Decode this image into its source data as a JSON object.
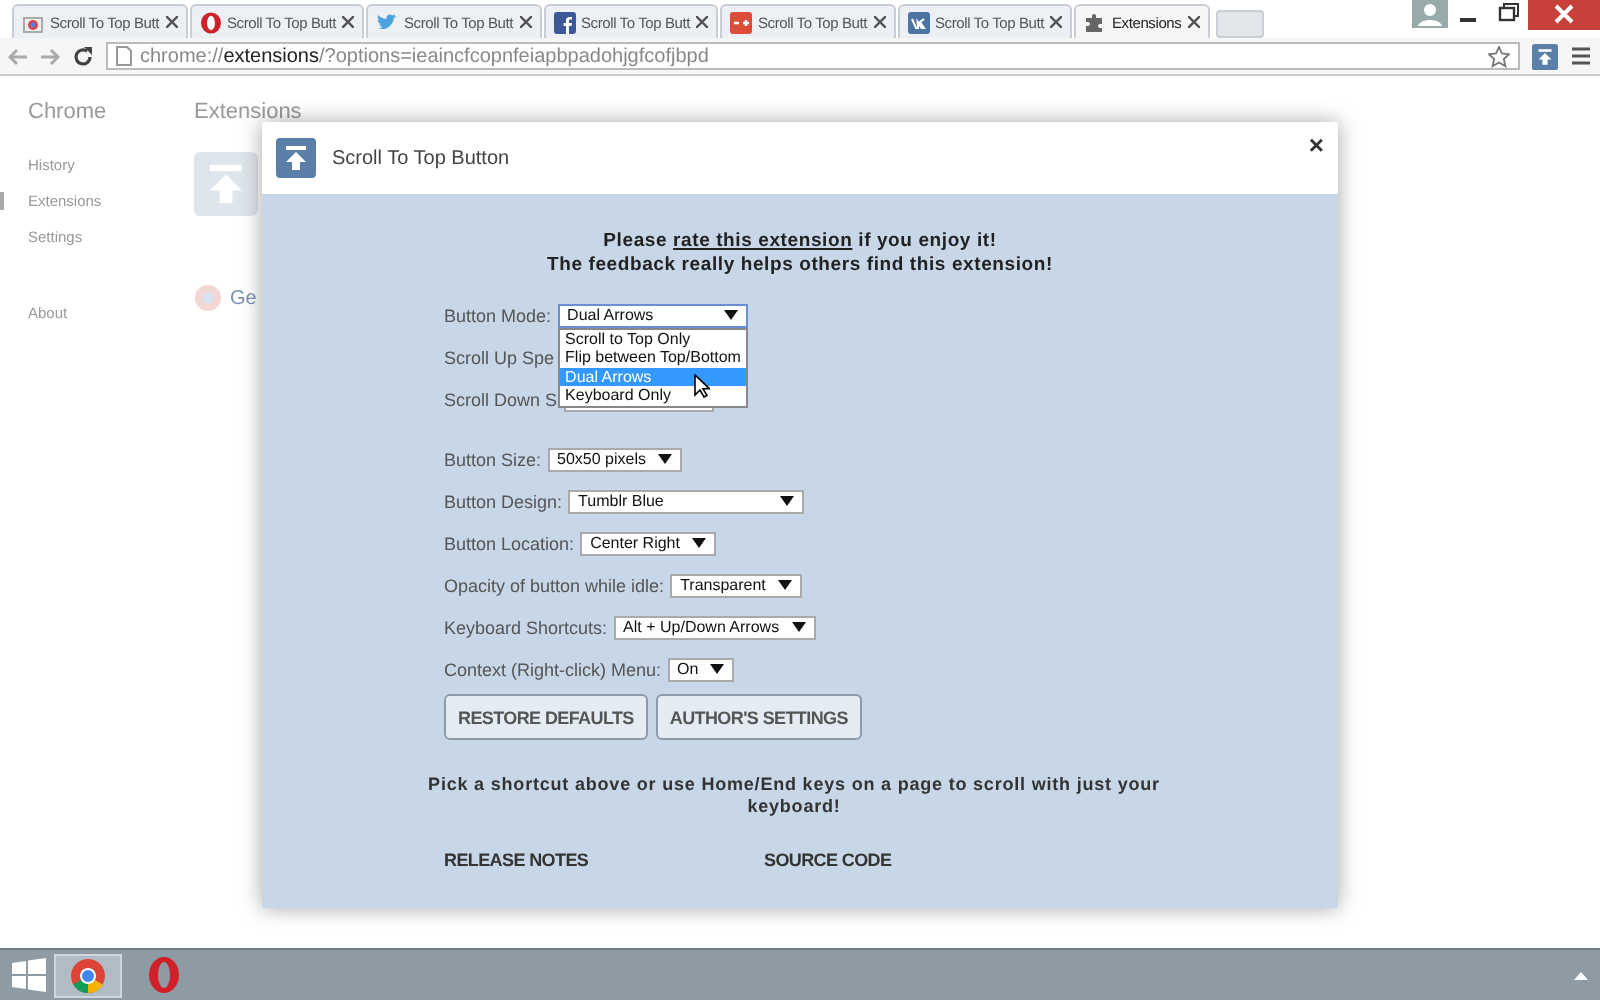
{
  "browser": {
    "tabs": [
      {
        "title": "Scroll To Top Butt",
        "kind": "store",
        "selected": false
      },
      {
        "title": "Scroll To Top Butt",
        "kind": "opera",
        "selected": false
      },
      {
        "title": "Scroll To Top Butt",
        "kind": "twitter",
        "selected": false
      },
      {
        "title": "Scroll To Top Butt",
        "kind": "facebook",
        "selected": false
      },
      {
        "title": "Scroll To Top Butt",
        "kind": "gplus",
        "selected": false
      },
      {
        "title": "Scroll To Top Butt",
        "kind": "vk",
        "selected": false
      },
      {
        "title": "Extensions",
        "kind": "puzzle",
        "selected": true
      }
    ],
    "url_scheme": "chrome://",
    "url_host": "extensions",
    "url_rest": "/?options=ieaincfcopnfeiapbpadohjgfcofjbpd"
  },
  "background_page": {
    "sidebar_title": "Chrome",
    "nav": [
      {
        "label": "History",
        "selected": false
      },
      {
        "label": "Extensions",
        "selected": true
      },
      {
        "label": "Settings",
        "selected": false
      },
      {
        "label": "About",
        "selected": false
      }
    ],
    "heading": "Extensions",
    "partial_text": "Ge"
  },
  "dialog": {
    "title": "Scroll To Top Button",
    "close": "×",
    "notice_before": "Please ",
    "notice_link": "rate this extension",
    "notice_after": " if you enjoy it!",
    "notice_line2": "The feedback really helps others find this extension!",
    "settings": [
      {
        "label": "Button Mode:",
        "kind": "open",
        "value": "Dual Arrows"
      },
      {
        "label": "Scroll Up Spe",
        "kind": "covered"
      },
      {
        "label": "Scroll Down S",
        "kind": "covered"
      },
      {
        "label": "Button Size:",
        "kind": "select",
        "value": "50x50 pixels"
      },
      {
        "label": "Button Design:",
        "kind": "select",
        "value": "Tumblr Blue"
      },
      {
        "label": "Button Location:",
        "kind": "select",
        "value": "Center Right"
      },
      {
        "label": "Opacity of button while idle:",
        "kind": "select",
        "value": "Transparent"
      },
      {
        "label": "Keyboard Shortcuts:",
        "kind": "select",
        "value": "Alt + Up/Down Arrows"
      },
      {
        "label": "Context (Right-click) Menu:",
        "kind": "select",
        "value": "On"
      }
    ],
    "dropdown_options": [
      {
        "label": "Scroll to Top Only",
        "selected": false
      },
      {
        "label": "Flip between Top/Bottom",
        "selected": false
      },
      {
        "label": "Dual Arrows",
        "selected": true
      },
      {
        "label": "Keyboard Only",
        "selected": false
      }
    ],
    "buttons": [
      "RESTORE DEFAULTS",
      "AUTHOR'S SETTINGS"
    ],
    "hint": "Pick a shortcut above or use Home/End keys on a page to scroll with just your keyboard!",
    "links": [
      "RELEASE NOTES",
      "SOURCE CODE"
    ]
  }
}
